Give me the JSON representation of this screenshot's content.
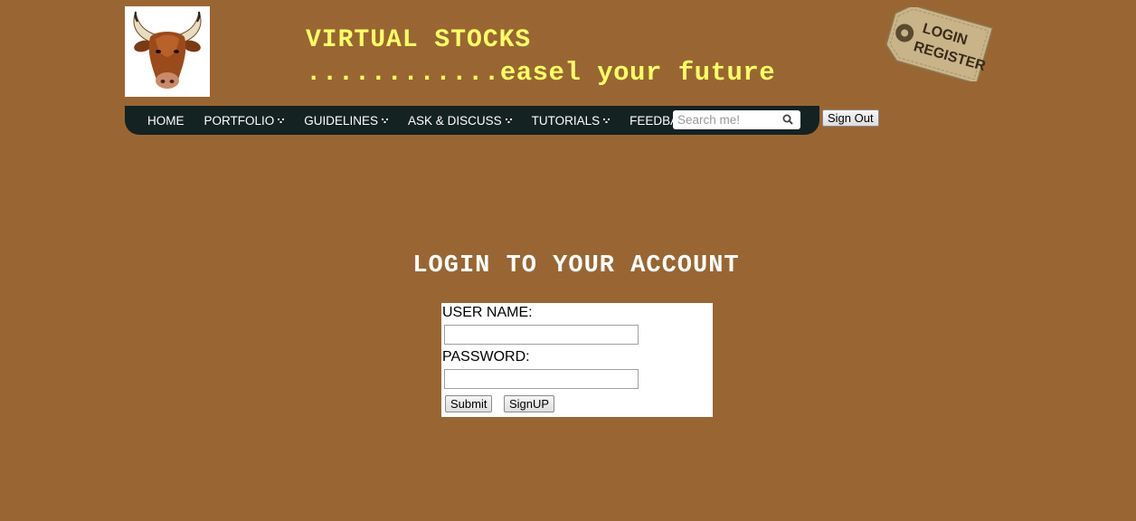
{
  "header": {
    "title": "VIRTUAL STOCKS",
    "tagline": "............easel your future",
    "logo_icon": "bull-head-icon",
    "tag_line1": "LOGIN",
    "tag_line2": "REGISTER"
  },
  "nav": {
    "items": [
      {
        "label": "HOME",
        "dropdown": false
      },
      {
        "label": "PORTFOLIO",
        "dropdown": true
      },
      {
        "label": "GUIDELINES",
        "dropdown": true
      },
      {
        "label": "ASK & DISCUSS",
        "dropdown": true
      },
      {
        "label": "TUTORIALS",
        "dropdown": true
      },
      {
        "label": "FEEDBACK",
        "dropdown": false
      }
    ],
    "search_placeholder": "Search me!",
    "search_value": ""
  },
  "signout_label": "Sign Out",
  "login": {
    "heading": "LOGIN TO YOUR ACCOUNT",
    "username_label": "USER NAME:",
    "username_value": "",
    "password_label": "PASSWORD:",
    "password_value": "",
    "submit_label": "Submit",
    "signup_label": "SignUP"
  },
  "colors": {
    "background": "#996633",
    "title": "#ffff66",
    "navbar": "#142222"
  }
}
